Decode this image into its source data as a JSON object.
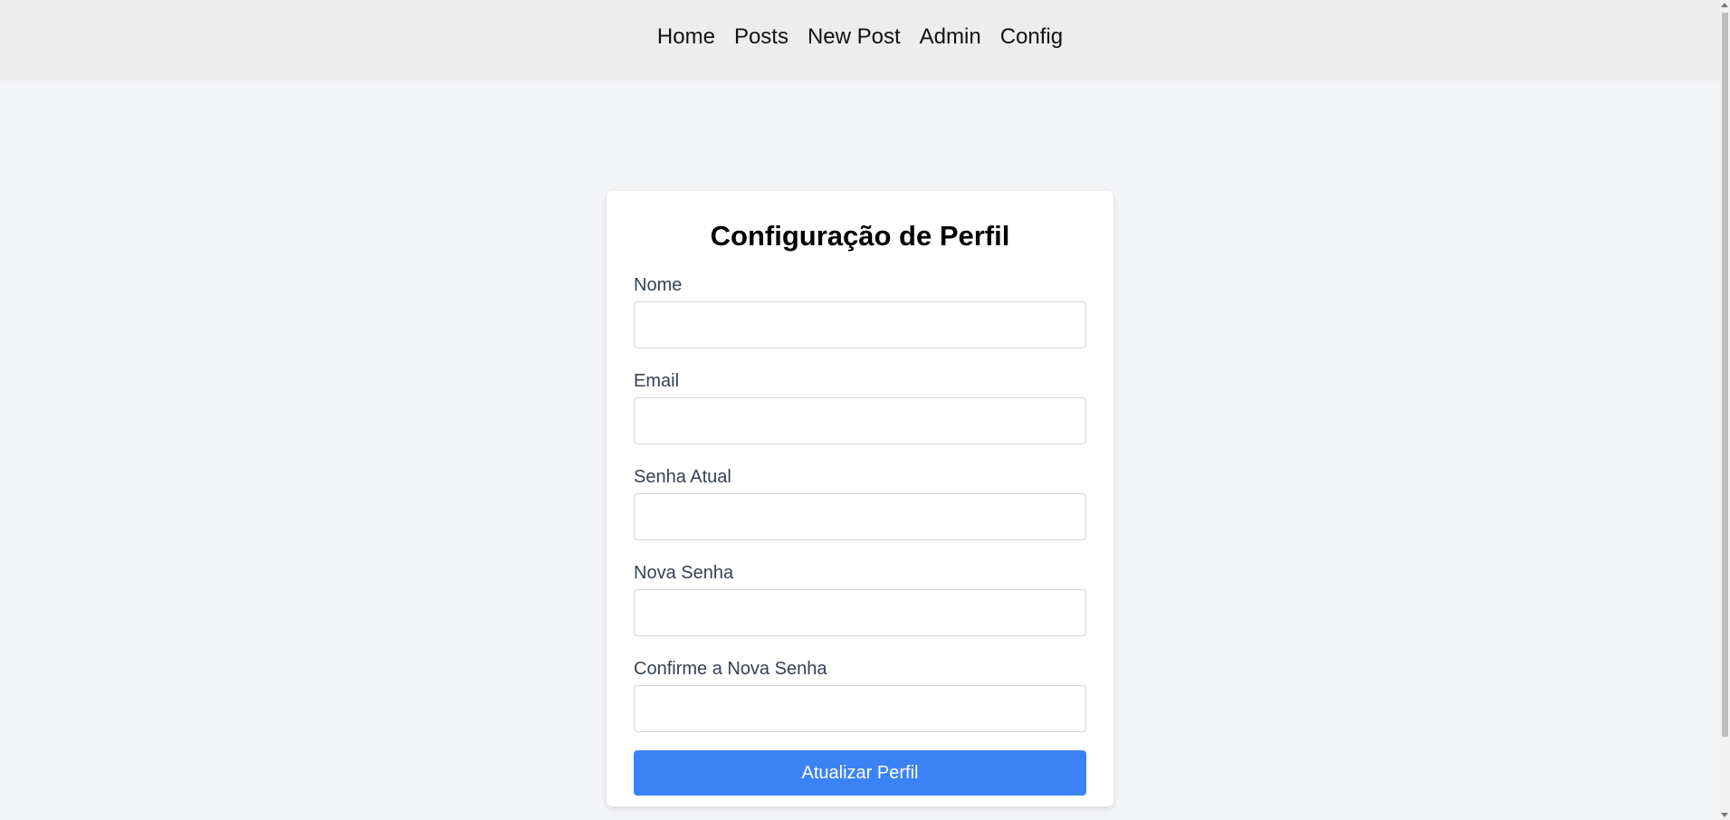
{
  "nav": {
    "items": [
      {
        "label": "Home"
      },
      {
        "label": "Posts"
      },
      {
        "label": "New Post"
      },
      {
        "label": "Admin"
      },
      {
        "label": "Config"
      }
    ]
  },
  "form": {
    "title": "Configuração de Perfil",
    "fields": [
      {
        "label": "Nome",
        "value": ""
      },
      {
        "label": "Email",
        "value": ""
      },
      {
        "label": "Senha Atual",
        "value": ""
      },
      {
        "label": "Nova Senha",
        "value": ""
      },
      {
        "label": "Confirme a Nova Senha",
        "value": ""
      }
    ],
    "submit_label": "Atualizar Perfil"
  },
  "colors": {
    "accent": "#3b82f6",
    "page_bg": "#f3f4f6",
    "nav_bg": "#ededed"
  }
}
